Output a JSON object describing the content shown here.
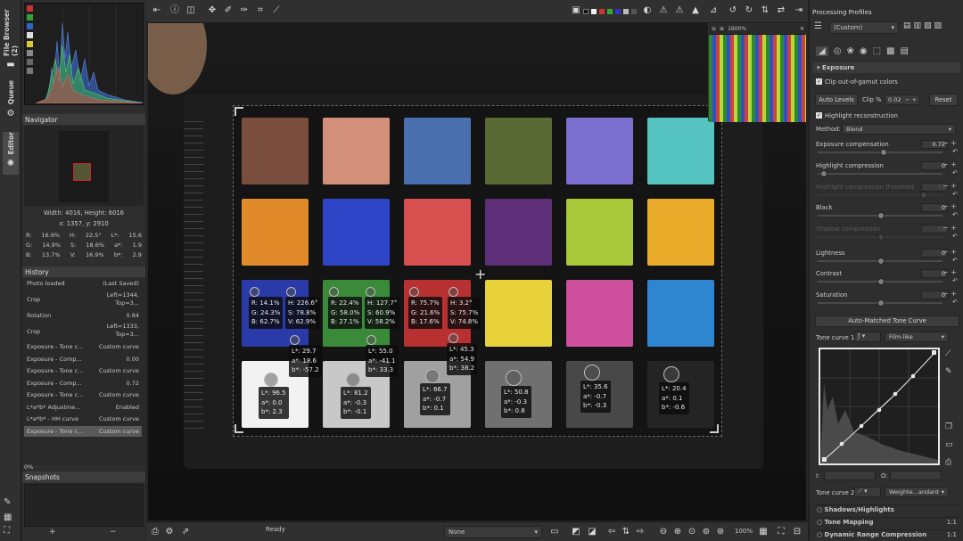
{
  "vtabs": [
    {
      "label": "File Browser (2)"
    },
    {
      "label": "Queue"
    },
    {
      "label": "Editor"
    }
  ],
  "navigator": {
    "title": "Navigator",
    "size": "Width: 4016, Height: 6016",
    "coords": "x: 1357, y: 2910",
    "readout": [
      [
        "R:",
        "16.9%",
        "H:",
        "22.5°",
        "L*:",
        "15.6"
      ],
      [
        "G:",
        "14.9%",
        "S:",
        "18.6%",
        "a*:",
        "1.9"
      ],
      [
        "B:",
        "13.7%",
        "V:",
        "16.9%",
        "b*:",
        "2.9"
      ]
    ]
  },
  "history": {
    "title": "History",
    "items": [
      {
        "name": "Photo loaded",
        "value": "(Last Saved)"
      },
      {
        "name": "Crop",
        "value": "Left=1344, Top=3... Width=972, Heigh..."
      },
      {
        "name": "Rotation",
        "value": "0.84"
      },
      {
        "name": "Crop",
        "value": "Left=1333, Top=3... Width=983, Heigh..."
      },
      {
        "name": "Exposure - Tone c...",
        "value": "Custom curve"
      },
      {
        "name": "Exposure - Comp...",
        "value": "0.00"
      },
      {
        "name": "Exposure - Tone c...",
        "value": "Custom curve"
      },
      {
        "name": "Exposure - Comp...",
        "value": "0.72"
      },
      {
        "name": "Exposure - Tone c...",
        "value": "Custom curve"
      },
      {
        "name": "L*a*b* Adjustme...",
        "value": "Enabled"
      },
      {
        "name": "L*a*b* - HH curve",
        "value": "Custom curve"
      },
      {
        "name": "Exposure - Tone c...",
        "value": "Custom curve"
      }
    ],
    "progress": "0%"
  },
  "snapshots": {
    "title": "Snapshots",
    "add": "+",
    "remove": "−"
  },
  "preview": {
    "zoom": "1600%"
  },
  "status": {
    "ready": "Ready",
    "preview_mode": "None",
    "zoom": "100%",
    "ratio": "1:1"
  },
  "colors": {
    "accent": "#4a90d9",
    "panel": "#2e2e2e",
    "canvas": "#151515"
  },
  "patches": [
    "#7a4e3c",
    "#d28f7a",
    "#4a6fae",
    "#5a6a34",
    "#7d6fd0",
    "#55c3c0",
    "#e08a2a",
    "#2f45c8",
    "#d85050",
    "#5c2f78",
    "#a8c83a",
    "#e8ac2a",
    "#2a3aa8",
    "#3a8a3a",
    "#b83030",
    "#e8d23a",
    "#d050a0",
    "#2e86d0",
    "#f2f2f2",
    "#c8c8c8",
    "#a0a0a0",
    "#707070",
    "#484848",
    "#242424"
  ],
  "overlays": {
    "blue": "R: 14.1%\nG: 24.3%\nB: 62.7%",
    "blue_hsv": "H: 226.6°\nS: 78.8%\nV: 62.9%",
    "blue_lab": "L*: 29.7\na*: 18.6\nb*: -57.2",
    "green": "R: 22.4%\nG: 58.0%\nB: 27.1%",
    "green_hsv": "H: 127.7°\nS: 60.9%\nV: 58.2%",
    "green_lab": "L*: 55.0\na*: -41.1\nb*: 33.3",
    "red": "R: 75.7%\nG: 21.6%\nB: 17.6%",
    "red_hsv": "H: 3.2°\nS: 75.7%\nV: 74.8%",
    "red_lab": "L*: 45.3\na*: 54.9\nb*: 38.2",
    "g1": "L*: 96.5\na*: 0.0\nb*: 2.3",
    "g2": "L*: 81.2\na*: -0.3\nb*: -0.1",
    "g3": "L*: 66.7\na*: -0.7\nb*: 0.1",
    "g4": "L*: 50.8\na*: -0.3\nb*: 0.8",
    "g5": "L*: 35.6\na*: -0.7\nb*: -0.3",
    "g6": "L*: 20.4\na*: 0.1\nb*: -0.6"
  },
  "right": {
    "profiles_title": "Processing Profiles",
    "profile": "(Custom)",
    "section": "Exposure",
    "clip": "Clip out-of-gamut colors",
    "auto_levels": "Auto Levels",
    "clip_pct": "Clip %",
    "clip_val": "0.02",
    "reset": "Reset",
    "hl_recon": "Highlight reconstruction",
    "method_lbl": "Method:",
    "method": "Blend",
    "sliders": [
      {
        "label": "Exposure compensation",
        "value": "0.72"
      },
      {
        "label": "Highlight compression",
        "value": "0"
      },
      {
        "label": "Highlight compression threshold",
        "value": "33"
      },
      {
        "label": "Black",
        "value": "0"
      },
      {
        "label": "Shadow compression",
        "value": "50"
      },
      {
        "label": "Lightness",
        "value": "0"
      },
      {
        "label": "Contrast",
        "value": "0"
      },
      {
        "label": "Saturation",
        "value": "0"
      }
    ],
    "auto_matched": "Auto-Matched Tone Curve",
    "tc1": "Tone curve 1:",
    "tc1_mode": "Film-like",
    "tc2": "Tone curve 2:",
    "tc2_mode": "Weighte...andard",
    "curve_i": "I:",
    "curve_o": "O:",
    "sub": [
      {
        "label": "Shadows/Highlights"
      },
      {
        "label": "Tone Mapping"
      },
      {
        "label": "Dynamic Range Compression"
      }
    ],
    "sub_ratio": "1:1"
  }
}
